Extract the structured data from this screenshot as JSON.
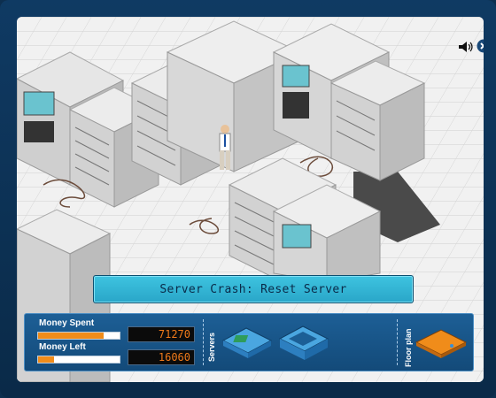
{
  "status": {
    "message": "Server Crash: Reset Server"
  },
  "stats": {
    "money_spent": {
      "label": "Money Spent",
      "value": "71270",
      "bar_fraction": 0.8
    },
    "money_left": {
      "label": "Money Left",
      "value": "16060",
      "bar_fraction": 0.2
    }
  },
  "toolbar": {
    "servers_label": "Servers",
    "floor_plan_label": "Floor plan",
    "items": [
      {
        "name": "server-rack-item",
        "icon": "server-board-icon"
      },
      {
        "name": "server-cabinet-item",
        "icon": "server-cabinet-icon"
      },
      {
        "name": "floor-tile-item",
        "icon": "floor-tile-icon"
      }
    ]
  },
  "controls": {
    "sound_icon": "speaker-icon",
    "close_icon": "close-icon"
  },
  "colors": {
    "hud_bg": "#1a5a8f",
    "banner": "#34b7d6",
    "lcd_text": "#f07a1a",
    "bar_fill": "#f08c1a",
    "frame": "#0f3a63"
  }
}
